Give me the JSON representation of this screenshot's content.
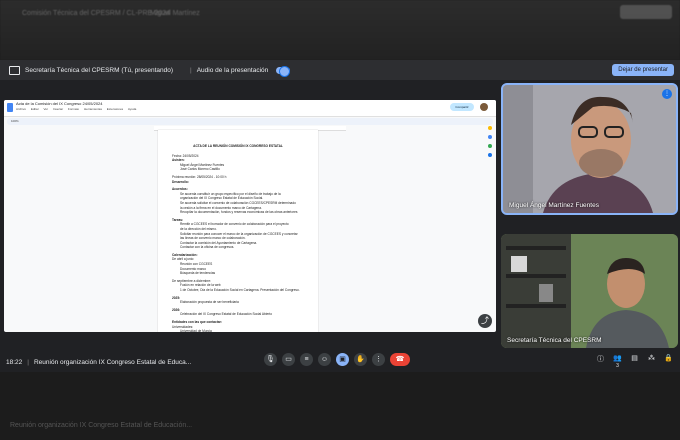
{
  "bg": {
    "top_text_1": "Comisión Técnica del CPESRM / CL-PRE-2024",
    "top_text_2": "Miguel Martínez",
    "bottom_text": "Reunión organización IX Congreso Estatal de Educación..."
  },
  "present_bar": {
    "title": "Secretaría Técnica del CPESRM (Tú, presentando)",
    "audio_label": "Audio de la presentación",
    "stop_label": "Dejar de presentar"
  },
  "doc": {
    "title": "Acta de la Comisión del IX Congreso 24/05/2024",
    "menu": [
      "Archivo",
      "Editar",
      "Ver",
      "Insertar",
      "Formato",
      "Herramientas",
      "Extensiones",
      "Ayuda"
    ],
    "share_label": "Compartir",
    "zoom": "100%",
    "lines": [
      {
        "t": "ACTA DE LA REUNIÓN COMISIÓN IX CONGRESO ESTATAL",
        "s": "h"
      },
      {
        "t": "Fecha: 24/05/2024",
        "s": ""
      },
      {
        "t": "Asisten:",
        "s": "b"
      },
      {
        "t": "Miguel Ángel Martínez Fuentes",
        "s": "i"
      },
      {
        "t": "José Carlos Moreno Castillo",
        "s": "i"
      },
      {
        "t": "",
        "s": "sp"
      },
      {
        "t": "Próxima reunión: 28/05/2024 - 10:00 h",
        "s": ""
      },
      {
        "t": "Desarrollo:",
        "s": "b"
      },
      {
        "t": "",
        "s": "sp"
      },
      {
        "t": "Acuerdos:",
        "s": "b"
      },
      {
        "t": "Se acuerda constituir un grupo específico por el diseño de trabajo de la",
        "s": "i"
      },
      {
        "t": "organización del IX Congreso Estatal de Educación Social.",
        "s": "i"
      },
      {
        "t": "Se acuerda solicitar el convenio de colaboración CGCEES/CPESRM determinado",
        "s": "i"
      },
      {
        "t": "la cesión a la firma en el documento marco de Cartagena.",
        "s": "i"
      },
      {
        "t": "Recopilar la documentación, fondos y reservas económicas de las obras anteriores",
        "s": "i"
      },
      {
        "t": "",
        "s": "sp"
      },
      {
        "t": "Tareas:",
        "s": "b"
      },
      {
        "t": "Remitir a CGCEES el borrador de convenio de colaboración para el proyecto",
        "s": "i"
      },
      {
        "t": "de la dirección del mismo.",
        "s": "i"
      },
      {
        "t": "Solicitar reunión para conocer el marco de la organización de CGCEES y concretar",
        "s": "i"
      },
      {
        "t": "las líneas de convenio marco de colaboración.",
        "s": "i"
      },
      {
        "t": "Contactar la comisión del Ayuntamiento de Cartagena.",
        "s": "i"
      },
      {
        "t": "Contactar con la oficina de congresos.",
        "s": "i"
      },
      {
        "t": "",
        "s": "sp"
      },
      {
        "t": "Calendarización:",
        "s": "b"
      },
      {
        "t": "De abril a junio:",
        "s": ""
      },
      {
        "t": "Reunión con CGCEES",
        "s": "i"
      },
      {
        "t": "Documento marco",
        "s": "i"
      },
      {
        "t": "Búsqueda de tendencias",
        "s": "i"
      },
      {
        "t": "",
        "s": "sp"
      },
      {
        "t": "De septiembre a diciembre:",
        "s": ""
      },
      {
        "t": "Fusión en relación de la web",
        "s": "i"
      },
      {
        "t": "1 de Octubre, Día de la Educación Social en Cartagena. Presentación del Congreso.",
        "s": "i"
      },
      {
        "t": "",
        "s": "sp"
      },
      {
        "t": "2025:",
        "s": "b"
      },
      {
        "t": "Elaboración propuesta de ser beneficiaria",
        "s": "i"
      },
      {
        "t": "",
        "s": "sp"
      },
      {
        "t": "2026:",
        "s": "b"
      },
      {
        "t": "Celebración del IX Congreso Estatal de Educación Social Abierto",
        "s": "i"
      },
      {
        "t": "",
        "s": "sp"
      },
      {
        "t": "Entidades con las que contactar:",
        "s": "b"
      },
      {
        "t": "Universidades:",
        "s": ""
      },
      {
        "t": "Universidad de Murcia",
        "s": "i"
      },
      {
        "t": "Universidad Católica de Murcia",
        "s": "i"
      },
      {
        "t": "UNED",
        "s": "i"
      },
      {
        "t": "UCO",
        "s": "i"
      }
    ]
  },
  "participants": [
    {
      "name": "Miguel Ángel Martínez Fuentes"
    },
    {
      "name": "Secretaría Técnica del CPESRM"
    }
  ],
  "bottom_bar": {
    "time": "18:22",
    "separator": "|",
    "meeting_title": "Reunión organización IX Congreso Estatal de Educa...",
    "participant_count": "3"
  },
  "icons": {
    "mic": "mic-icon",
    "camera": "camera-icon",
    "captions": "captions-icon",
    "emoji": "emoji-icon",
    "present": "present-icon",
    "hand": "raise-hand-icon",
    "more": "more-icon",
    "hangup": "hangup-icon"
  },
  "colors": {
    "accent": "#8ab4f8",
    "hangup": "#ea4335",
    "meet_bg": "#202124"
  }
}
